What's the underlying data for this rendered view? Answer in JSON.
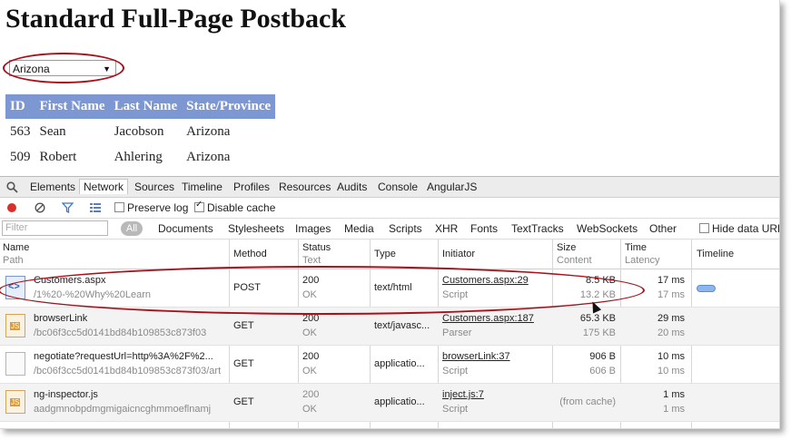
{
  "page": {
    "title": "Standard Full-Page Postback",
    "select_value": "Arizona",
    "table": {
      "headers": [
        "ID",
        "First Name",
        "Last Name",
        "State/Province"
      ],
      "rows": [
        [
          "563",
          "Sean",
          "Jacobson",
          "Arizona"
        ],
        [
          "509",
          "Robert",
          "Ahlering",
          "Arizona"
        ]
      ]
    }
  },
  "devtools": {
    "tabs": [
      "Elements",
      "Network",
      "Sources",
      "Timeline",
      "Profiles",
      "Resources",
      "Audits",
      "Console",
      "AngularJS"
    ],
    "active_tab": "Network",
    "toolbar": {
      "preserve_log": "Preserve log",
      "disable_cache": "Disable cache"
    },
    "filter": {
      "placeholder": "Filter",
      "all": "All",
      "types": [
        "Documents",
        "Stylesheets",
        "Images",
        "Media",
        "Scripts",
        "XHR",
        "Fonts",
        "TextTracks",
        "WebSockets",
        "Other"
      ],
      "hide_data_urls": "Hide data URL"
    },
    "columns": {
      "name": "Name",
      "path": "Path",
      "method": "Method",
      "status": "Status",
      "text": "Text",
      "type": "Type",
      "initiator": "Initiator",
      "size": "Size",
      "content": "Content",
      "time": "Time",
      "latency": "Latency",
      "timeline": "Timeline"
    },
    "requests": [
      {
        "name": "Customers.aspx",
        "path": "/1%20-%20Why%20Learn",
        "method": "POST",
        "status": "200",
        "status_text": "OK",
        "type": "text/html",
        "initiator": "Customers.aspx:29",
        "initiator_sub": "Script",
        "size": "8.5 KB",
        "content": "13.2 KB",
        "time": "17 ms",
        "latency": "17 ms",
        "icon": "html-file-icon"
      },
      {
        "name": "browserLink",
        "path": "/bc06f3cc5d0141bd84b109853c873f03",
        "method": "GET",
        "status": "200",
        "status_text": "OK",
        "type": "text/javasc...",
        "initiator": "Customers.aspx:187",
        "initiator_sub": "Parser",
        "size": "65.3 KB",
        "content": "175 KB",
        "time": "29 ms",
        "latency": "20 ms",
        "icon": "js-file-icon"
      },
      {
        "name": "negotiate?requestUrl=http%3A%2F%2...",
        "path": "/bc06f3cc5d0141bd84b109853c873f03/art",
        "method": "GET",
        "status": "200",
        "status_text": "OK",
        "type": "applicatio...",
        "initiator": "browserLink:37",
        "initiator_sub": "Script",
        "size": "906 B",
        "content": "606 B",
        "time": "10 ms",
        "latency": "10 ms",
        "icon": "blank-file-icon"
      },
      {
        "name": "ng-inspector.js",
        "path": "aadgmnobpdmgmigaicncghmmoeflnamj",
        "method": "GET",
        "status": "200",
        "status_text": "OK",
        "type": "applicatio...",
        "initiator": "inject.js:7",
        "initiator_sub": "Script",
        "size": "",
        "content": "(from cache)",
        "time": "1 ms",
        "latency": "1 ms",
        "icon": "js-file-icon"
      }
    ]
  }
}
